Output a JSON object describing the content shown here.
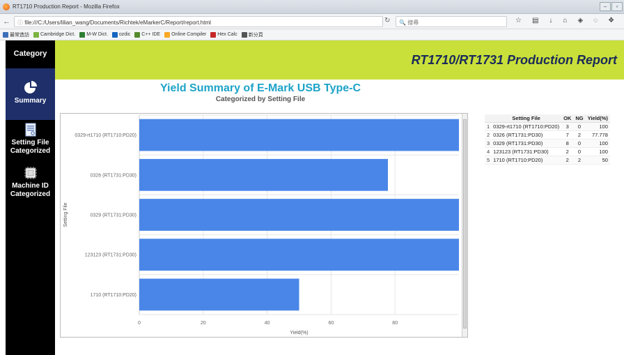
{
  "browser": {
    "window_title": "RT1710 Production Report - Mozilla Firefox",
    "url": "file:///C:/Users/lilian_wang/Documents/Richtek/eMarkerC/Report/report.html",
    "search_placeholder": "搜尋",
    "bookmarks": [
      {
        "label": "最常造訪",
        "color": "#3d6fb8"
      },
      {
        "label": "Cambridge Dict.",
        "color": "#7cb342"
      },
      {
        "label": "M-W Dict.",
        "color": "#2e7d32"
      },
      {
        "label": "ozdic",
        "color": "#1565c0"
      },
      {
        "label": "C++ IDE",
        "color": "#558b2f"
      },
      {
        "label": "Online Compiler",
        "color": "#f9a825"
      },
      {
        "label": "Hex Calc",
        "color": "#c62828"
      },
      {
        "label": "新分頁",
        "color": "#555555"
      }
    ]
  },
  "sidebar": {
    "heading": "Category",
    "items": [
      {
        "label": "Summary"
      },
      {
        "label": "Setting File Categorized"
      },
      {
        "label": "Machine ID Categorized"
      }
    ]
  },
  "header": {
    "title": "RT1710/RT1731 Production Report"
  },
  "chart": {
    "title": "Yield Summary of E-Mark USB Type-C",
    "subtitle": "Categorized by Setting File"
  },
  "chart_data": {
    "type": "bar",
    "orientation": "horizontal",
    "title": "Yield Summary of E-Mark USB Type-C",
    "subtitle": "Categorized by Setting File",
    "xlabel": "Yield(%)",
    "ylabel": "Setting File",
    "categories": [
      "0329-rt1710 (RT1710:PD20)",
      "0326 (RT1731:PD30)",
      "0329 (RT1731:PD30)",
      "123123 (RT1731:PD30)",
      "1710 (RT1710:PD20)"
    ],
    "values": [
      100,
      77.778,
      100,
      100,
      50
    ],
    "xlim": [
      0,
      100
    ],
    "xticks": [
      0,
      20,
      40,
      60,
      80
    ],
    "bar_color": "#4a86e8",
    "grid": true
  },
  "table": {
    "headers": [
      "",
      "Setting File",
      "OK",
      "NG",
      "Yield(%)"
    ],
    "rows": [
      [
        "1",
        "0329-rt1710 (RT1710:PD20)",
        "3",
        "0",
        "100"
      ],
      [
        "2",
        "0326 (RT1731:PD30)",
        "7",
        "2",
        "77.778"
      ],
      [
        "3",
        "0329 (RT1731:PD30)",
        "8",
        "0",
        "100"
      ],
      [
        "4",
        "123123 (RT1731:PD30)",
        "2",
        "0",
        "100"
      ],
      [
        "5",
        "1710 (RT1710:PD20)",
        "2",
        "2",
        "50"
      ]
    ]
  }
}
